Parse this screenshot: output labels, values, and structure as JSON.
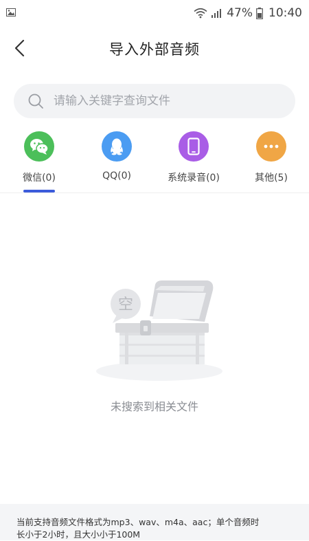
{
  "status_bar": {
    "battery_percent": "47%",
    "time": "10:40",
    "icons": [
      "image-icon",
      "wifi-icon",
      "signal-icon",
      "battery-icon"
    ]
  },
  "header": {
    "title": "导入外部音频",
    "back_icon": "chevron-left-icon"
  },
  "search": {
    "placeholder": "请输入关键字查询文件",
    "value": "",
    "icon": "search-icon"
  },
  "tabs": [
    {
      "label": "微信(0)",
      "icon": "wechat-icon",
      "color": "#4cbf5a",
      "active": true
    },
    {
      "label": "QQ(0)",
      "icon": "qq-penguin-icon",
      "color": "#4b9cf2",
      "active": false
    },
    {
      "label": "系统录音(0)",
      "icon": "phone-icon",
      "color": "#a95de6",
      "active": false
    },
    {
      "label": "其他(5)",
      "icon": "more-dots-icon",
      "color": "#f0a645",
      "active": false
    }
  ],
  "active_tab_color": "#3b5bdb",
  "empty_state": {
    "badge_text": "空",
    "message": "未搜索到相关文件",
    "illustration_icon": "empty-chest-icon"
  },
  "footer": {
    "line1": "当前支持音频文件格式为mp3、wav、m4a、aac；单个音频时",
    "line2": "长小于2小时，且大小小于100M"
  }
}
